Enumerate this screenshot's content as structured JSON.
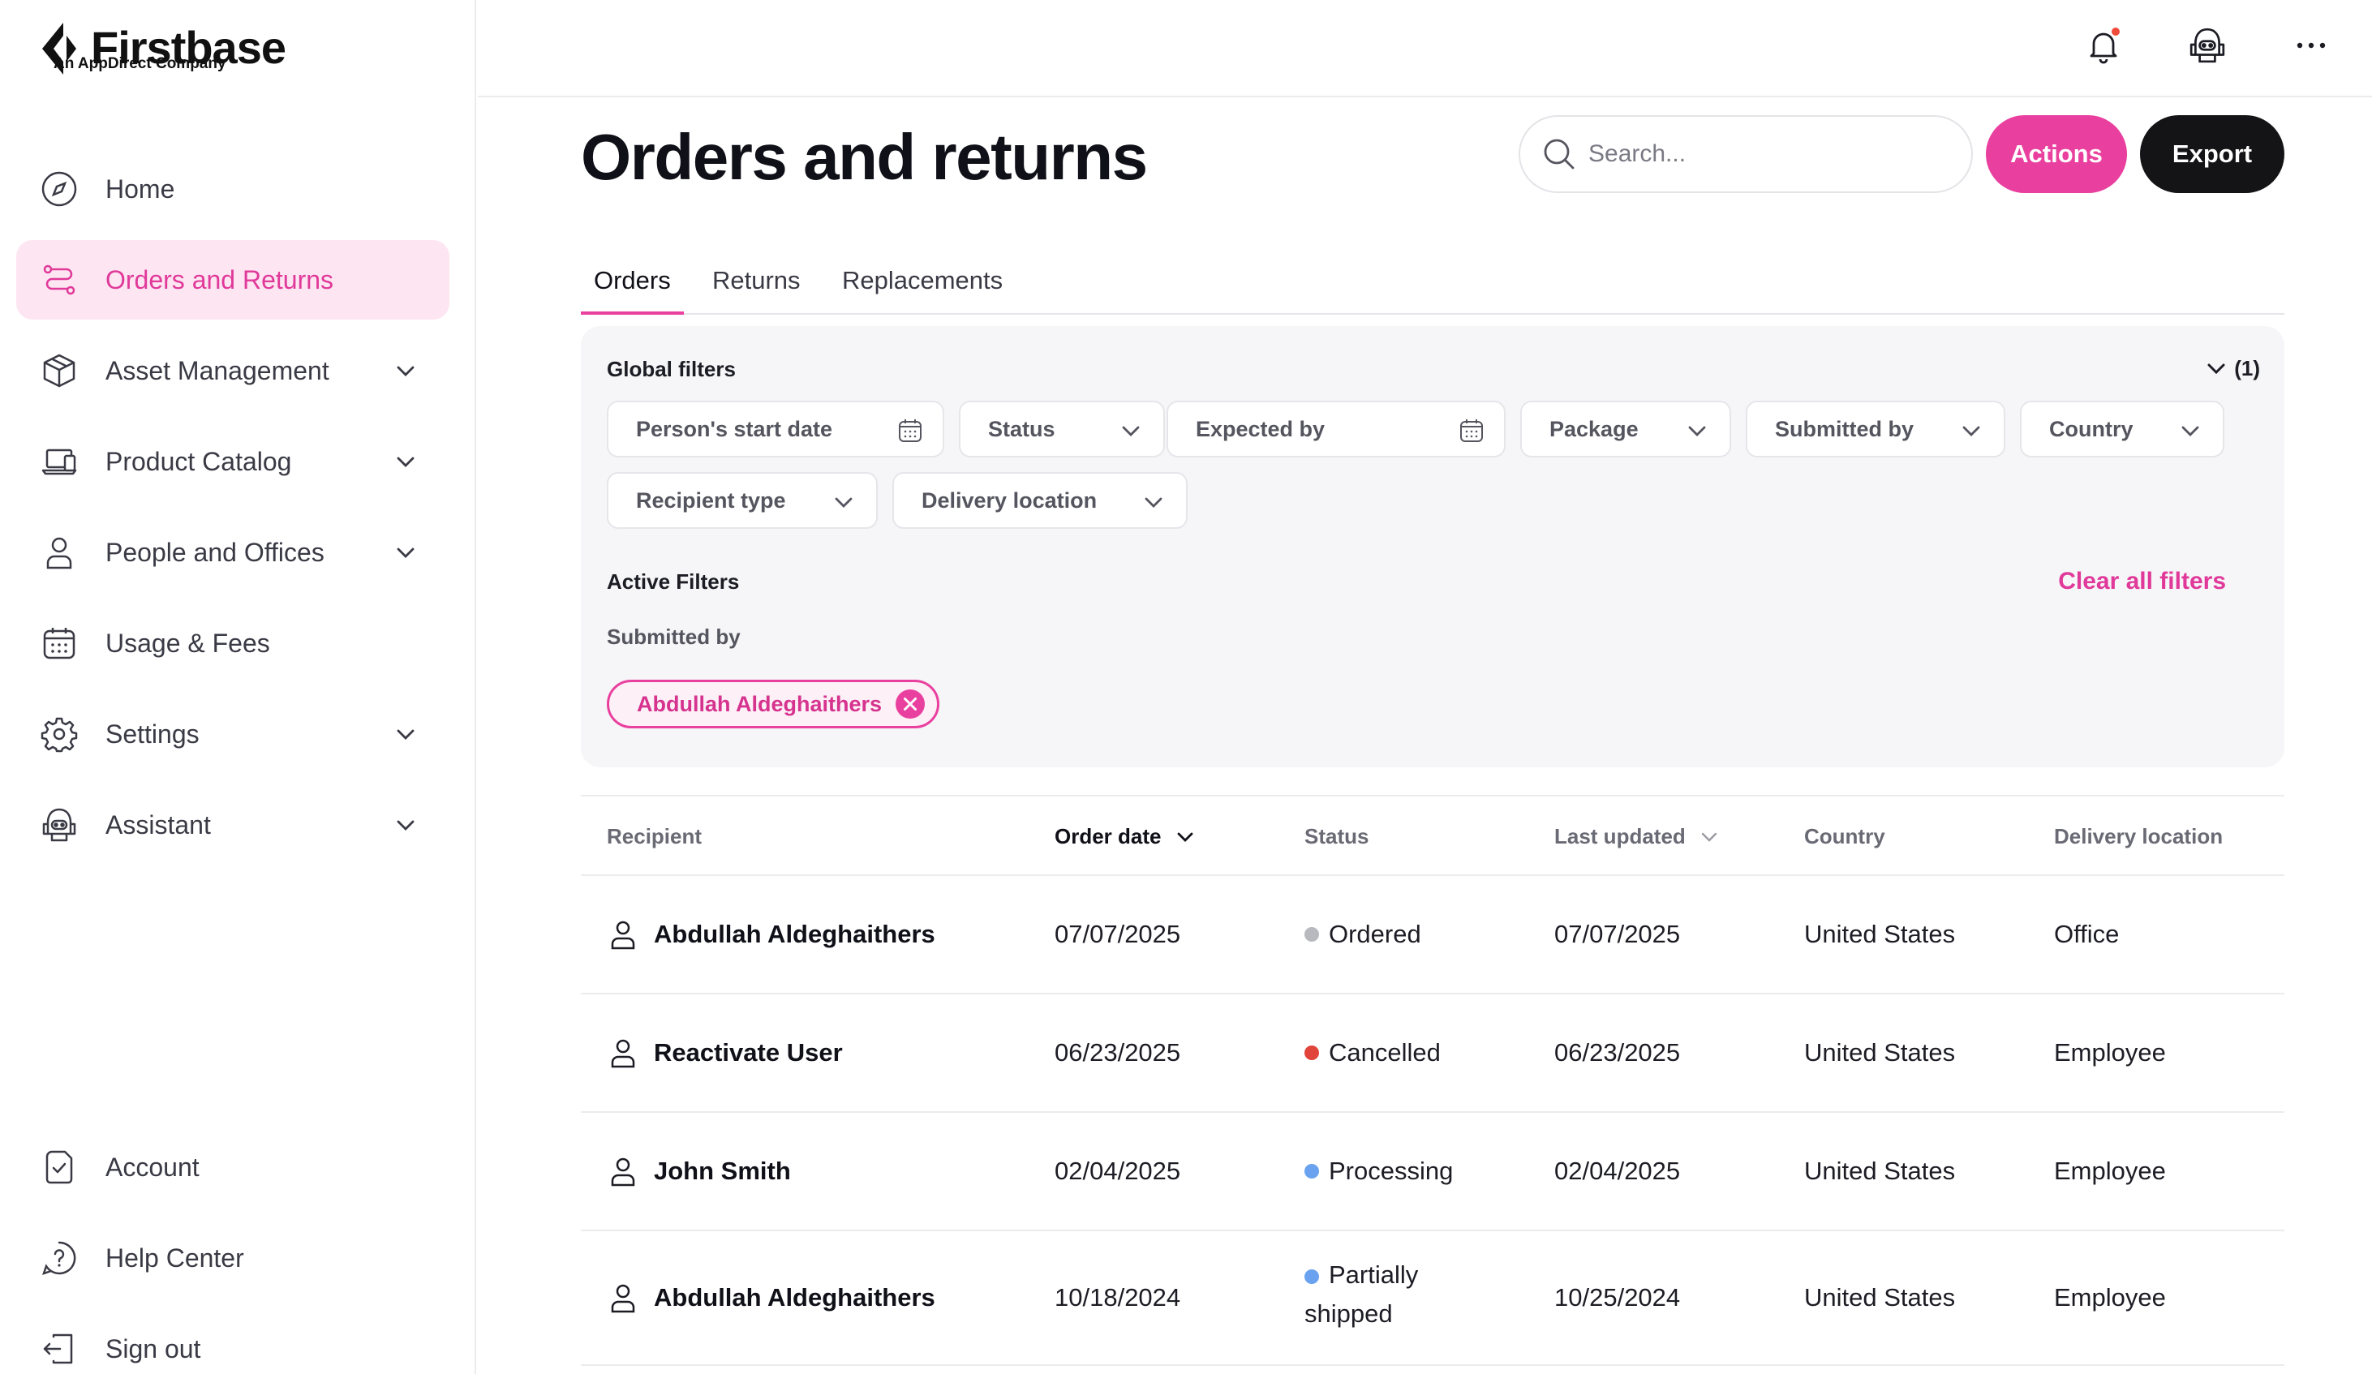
{
  "brand": {
    "name": "Firstbase",
    "tagline": "An AppDirect Company"
  },
  "sidebar": {
    "items": [
      {
        "label": "Home",
        "icon": "compass-icon",
        "active": false,
        "expandable": false
      },
      {
        "label": "Orders and Returns",
        "icon": "route-icon",
        "active": true,
        "expandable": false
      },
      {
        "label": "Asset Management",
        "icon": "cube-icon",
        "active": false,
        "expandable": true
      },
      {
        "label": "Product Catalog",
        "icon": "laptop-icon",
        "active": false,
        "expandable": true
      },
      {
        "label": "People and Offices",
        "icon": "person-icon",
        "active": false,
        "expandable": true
      },
      {
        "label": "Usage & Fees",
        "icon": "calendar-icon",
        "active": false,
        "expandable": false
      },
      {
        "label": "Settings",
        "icon": "gear-icon",
        "active": false,
        "expandable": true
      },
      {
        "label": "Assistant",
        "icon": "robot-icon",
        "active": false,
        "expandable": true
      }
    ],
    "bottom": [
      {
        "label": "Account",
        "icon": "document-check-icon"
      },
      {
        "label": "Help Center",
        "icon": "help-icon"
      },
      {
        "label": "Sign out",
        "icon": "sign-out-icon"
      }
    ]
  },
  "header": {
    "title": "Orders and returns",
    "search_placeholder": "Search...",
    "actions_label": "Actions",
    "export_label": "Export"
  },
  "tabs": [
    {
      "label": "Orders",
      "active": true
    },
    {
      "label": "Returns",
      "active": false
    },
    {
      "label": "Replacements",
      "active": false
    }
  ],
  "filters": {
    "global_title": "Global filters",
    "count_badge": "(1)",
    "chips": {
      "start_date": "Person's start date",
      "status": "Status",
      "expected_by": "Expected by",
      "package": "Package",
      "submitted_by": "Submitted by",
      "country": "Country",
      "recipient_type": "Recipient type",
      "delivery_location": "Delivery location"
    },
    "active_title": "Active Filters",
    "clear_label": "Clear all filters",
    "active_group_label": "Submitted by",
    "active_value": "Abdullah Aldeghaithers"
  },
  "table": {
    "columns": {
      "recipient": "Recipient",
      "order_date": "Order date",
      "status": "Status",
      "last_updated": "Last updated",
      "country": "Country",
      "delivery_location": "Delivery location"
    },
    "rows": [
      {
        "recipient": "Abdullah Aldeghaithers",
        "order_date": "07/07/2025",
        "status": "Ordered",
        "status_color": "#b8b8bf",
        "last_updated": "07/07/2025",
        "country": "United States",
        "delivery_location": "Office"
      },
      {
        "recipient": "Reactivate User",
        "order_date": "06/23/2025",
        "status": "Cancelled",
        "status_color": "#e0443a",
        "last_updated": "06/23/2025",
        "country": "United States",
        "delivery_location": "Employee"
      },
      {
        "recipient": "John Smith",
        "order_date": "02/04/2025",
        "status": "Processing",
        "status_color": "#6aa2ef",
        "last_updated": "02/04/2025",
        "country": "United States",
        "delivery_location": "Employee"
      },
      {
        "recipient": "Abdullah Aldeghaithers",
        "order_date": "10/18/2024",
        "status": "Partially shipped",
        "status_color": "#6aa2ef",
        "last_updated": "10/25/2024",
        "country": "United States",
        "delivery_location": "Employee"
      }
    ]
  },
  "colors": {
    "accent": "#e9409f",
    "dark": "#141416",
    "panel": "#f6f6f8"
  }
}
